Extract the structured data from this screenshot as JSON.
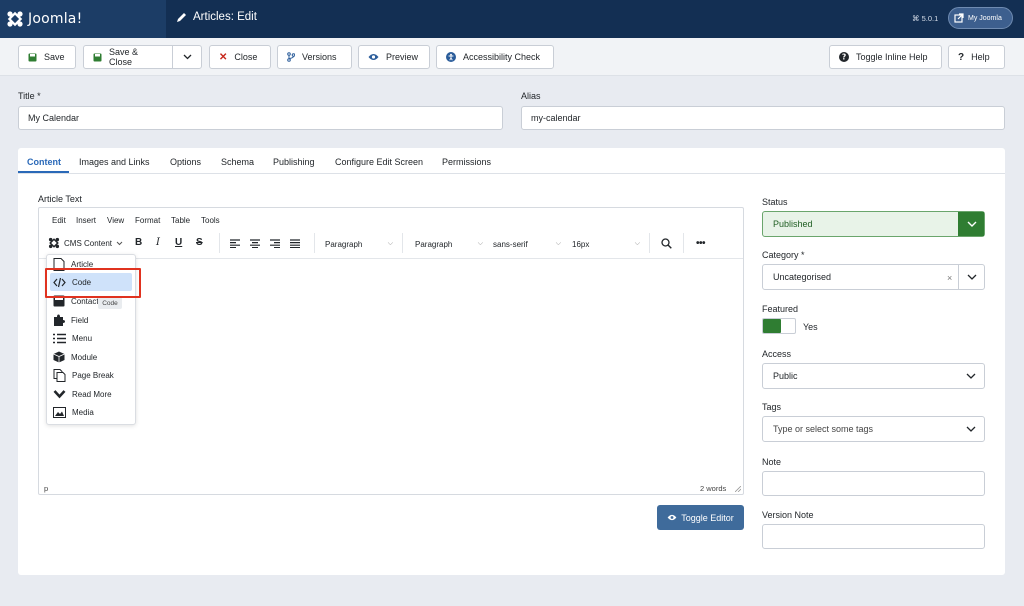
{
  "header": {
    "logo_text": "Joomla!",
    "page_title": "Articles: Edit",
    "version": "⌘ 5.0.1",
    "my_joomla": "My Joomla"
  },
  "toolbar": {
    "save": "Save",
    "save_close": "Save & Close",
    "close": "Close",
    "versions": "Versions",
    "preview": "Preview",
    "accessibility": "Accessibility Check",
    "toggle_help": "Toggle Inline Help",
    "help": "Help"
  },
  "fields": {
    "title_label": "Title *",
    "title_value": "My Calendar",
    "alias_label": "Alias",
    "alias_value": "my-calendar"
  },
  "tabs": [
    "Content",
    "Images and Links",
    "Options",
    "Schema",
    "Publishing",
    "Configure Edit Screen",
    "Permissions"
  ],
  "editor": {
    "label": "Article Text",
    "menus": [
      "Edit",
      "Insert",
      "View",
      "Format",
      "Table",
      "Tools"
    ],
    "cms_content": "CMS Content",
    "block_format": "Paragraph",
    "block_format2": "Paragraph",
    "font_family": "sans-serif",
    "font_size": "16px",
    "path": "p",
    "word_count": "2 words",
    "toggle_editor": "Toggle Editor"
  },
  "cms_menu": {
    "items": [
      "Article",
      "Code",
      "Contact",
      "Field",
      "Menu",
      "Module",
      "Page Break",
      "Read More",
      "Media"
    ],
    "tooltip": "Code",
    "highlighted": "Code"
  },
  "sidebar": {
    "status_label": "Status",
    "status_value": "Published",
    "category_label": "Category *",
    "category_value": "Uncategorised",
    "featured_label": "Featured",
    "featured_value": "Yes",
    "access_label": "Access",
    "access_value": "Public",
    "tags_label": "Tags",
    "tags_placeholder": "Type or select some tags",
    "note_label": "Note",
    "version_note_label": "Version Note"
  },
  "colors": {
    "header_bg": "#132f53",
    "status_green": "#2f7d32",
    "toggle_editor_bg": "#3f6b9b",
    "highlight_red": "#e0321f"
  }
}
